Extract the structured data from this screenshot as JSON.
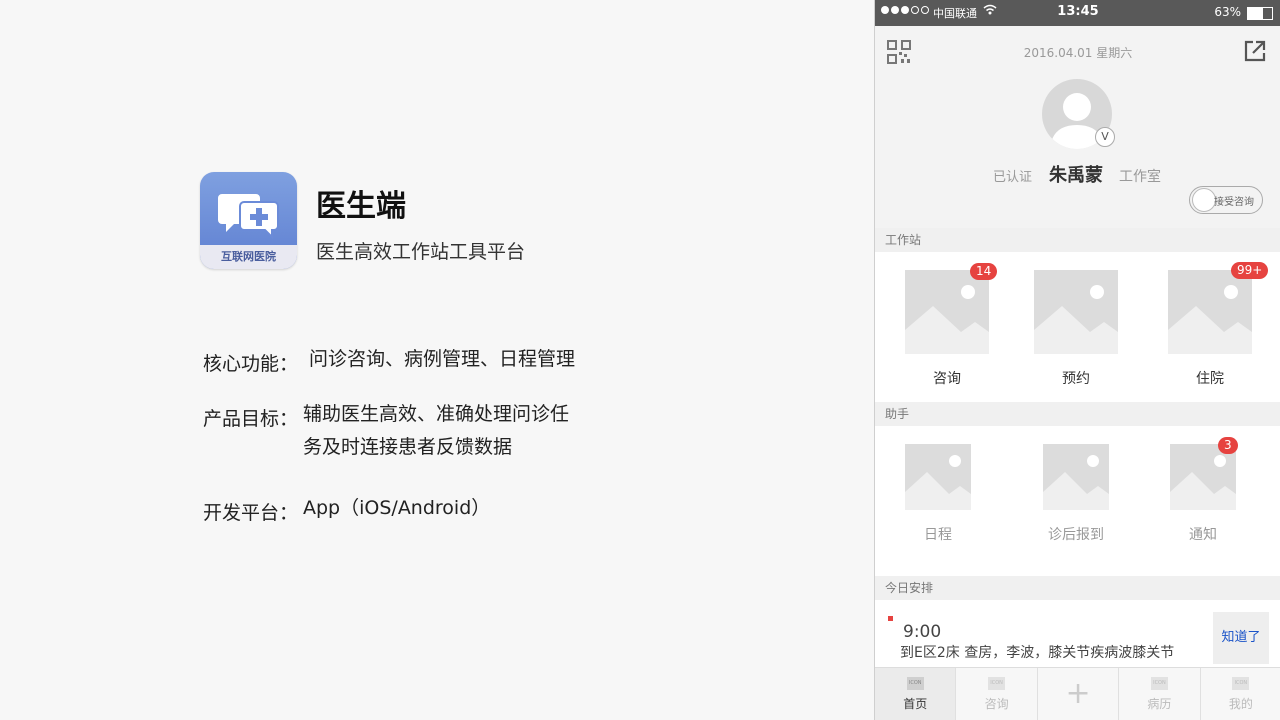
{
  "intro": {
    "icon_label": "互联网医院",
    "title": "医生端",
    "subtitle": "医生高效工作站工具平台",
    "core_label": "核心功能：",
    "core_value": "问诊咨询、病例管理、日程管理",
    "goal_label": "产品目标：",
    "goal_value_line1": "辅助医生高效、准确处理问诊任",
    "goal_value_line2": "务及时连接患者反馈数据",
    "platform_label": "开发平台：",
    "platform_value": "App（iOS/Android）"
  },
  "statusbar": {
    "carrier": "中国联通",
    "time": "13:45",
    "battery": "63%"
  },
  "profile": {
    "date": "2016.04.01 星期六",
    "verified": "已认证",
    "name": "朱禹蒙",
    "studio": "工作室",
    "v_badge": "V",
    "consult_toggle": "接受咨询"
  },
  "workstation": {
    "header": "工作站",
    "items": [
      {
        "label": "咨询",
        "badge": "14"
      },
      {
        "label": "预约",
        "badge": ""
      },
      {
        "label": "住院",
        "badge": "99+"
      }
    ]
  },
  "assistant": {
    "header": "助手",
    "items": [
      {
        "label": "日程",
        "badge": ""
      },
      {
        "label": "诊后报到",
        "badge": ""
      },
      {
        "label": "通知",
        "badge": "3"
      }
    ]
  },
  "today": {
    "header": "今日安排",
    "time": "9:00",
    "desc": "到E区2床  查房，李波，膝关节疾病波膝关节",
    "ack_button": "知道了"
  },
  "tabbar": {
    "icon_text": "ICON",
    "items": [
      {
        "label": "首页"
      },
      {
        "label": "咨询"
      },
      {
        "label": "+"
      },
      {
        "label": "病历"
      },
      {
        "label": "我的"
      }
    ]
  }
}
